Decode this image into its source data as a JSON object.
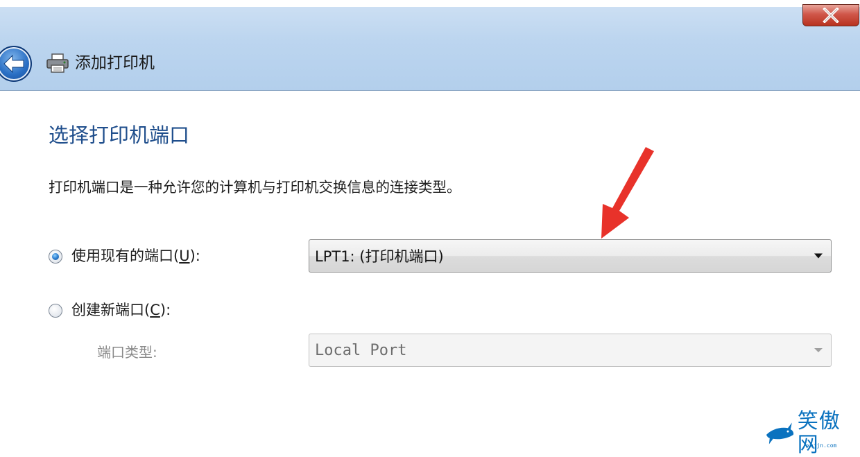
{
  "window": {
    "title": "添加打印机",
    "close_label": "X"
  },
  "page": {
    "heading": "选择打印机端口",
    "description": "打印机端口是一种允许您的计算机与打印机交换信息的连接类型。"
  },
  "options": {
    "use_existing": {
      "label_text": "使用现有的端口(",
      "accel": "U",
      "label_suffix": "):",
      "selected": true,
      "value": "LPT1: (打印机端口)"
    },
    "create_new": {
      "label_text": "创建新端口(",
      "accel": "C",
      "label_suffix": "):",
      "selected": false,
      "port_type_label": "端口类型:",
      "port_type_value": "Local Port"
    }
  },
  "watermark": {
    "text": "笑傲网",
    "url": "xajjn.com"
  },
  "colors": {
    "heading": "#1f4e8c",
    "header_band": "#bcd5ef",
    "annotation_arrow": "#e8322a",
    "watermark": "#0a72bf"
  }
}
